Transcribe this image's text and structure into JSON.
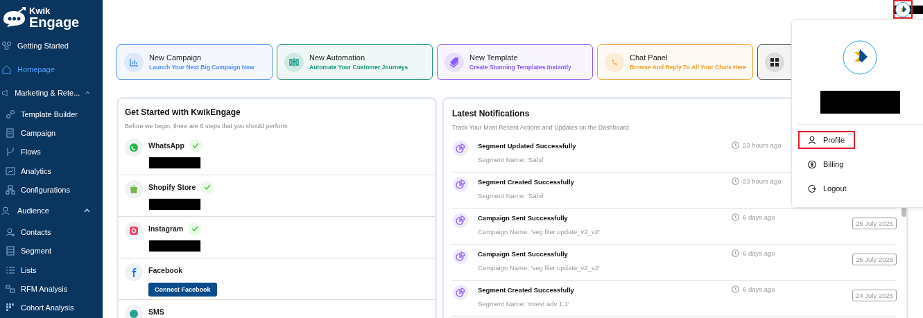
{
  "logo": {
    "line1": "Kwik",
    "line2": "Engage"
  },
  "sidebar": {
    "items": [
      {
        "label": "Getting Started",
        "selected": false
      },
      {
        "label": "Homepage",
        "selected": true
      },
      {
        "label": "Marketing & Rete...",
        "selected": false,
        "expanded": true,
        "children": [
          {
            "label": "Template Builder",
            "selected": false
          },
          {
            "label": "Campaign",
            "selected": false
          },
          {
            "label": "Flows",
            "selected": false
          },
          {
            "label": "Analytics",
            "selected": false
          },
          {
            "label": "Configurations",
            "selected": false
          }
        ]
      },
      {
        "label": "Audience",
        "selected": false,
        "expanded": true,
        "children": [
          {
            "label": "Contacts",
            "selected": false
          },
          {
            "label": "Segment",
            "selected": false
          },
          {
            "label": "Lists",
            "selected": false
          },
          {
            "label": "RFM Analysis",
            "selected": false
          },
          {
            "label": "Cohort Analysis",
            "selected": false
          }
        ]
      }
    ]
  },
  "quick_actions": [
    {
      "title": "New Campaign",
      "subtitle": "Launch Your Next Big Campaign Now",
      "color": "#4f8ef7"
    },
    {
      "title": "New Automation",
      "subtitle": "Automate Your Customer Journeys",
      "color": "#16957c"
    },
    {
      "title": "New Template",
      "subtitle": "Create Stunning Templates Instantly",
      "color": "#8b5cf6"
    },
    {
      "title": "Chat Panel",
      "subtitle": "Browse And Reply To All Your Chats Here",
      "color": "#f0a030"
    },
    {
      "color": "#555555"
    }
  ],
  "get_started": {
    "title": "Get Started with KwikEngage",
    "subtitle": "Before we begin, there are 6 steps that you should perform",
    "steps": [
      {
        "name": "WhatsApp",
        "connected": true
      },
      {
        "name": "Shopify Store",
        "connected": true
      },
      {
        "name": "Instagram",
        "connected": true
      },
      {
        "name": "Facebook",
        "connected": false,
        "button": "Connect Facebook"
      },
      {
        "name": "SMS",
        "connected": false
      }
    ]
  },
  "notifications": {
    "title": "Latest Notifications",
    "subtitle": "Track Your Most Recent Actions and Updates on the Dashboard",
    "items": [
      {
        "title": "Segment Updated Successfully",
        "detail": "Segment Name: 'Sahil'",
        "time": "23 hours ago"
      },
      {
        "title": "Segment Created Successfully",
        "detail": "Segment Name: 'Sahil'",
        "time": "23 hours ago"
      },
      {
        "title": "Campaign Sent Successfully",
        "detail": "Campaign Name: 'seg filer update_v2_v2'",
        "time": "6 days ago",
        "date": "25 July 2025"
      },
      {
        "title": "Campaign Sent Successfully",
        "detail": "Campaign Name: 'seg filer update_v2_v2'",
        "time": "6 days ago",
        "date": "25 July 2025"
      },
      {
        "title": "Segment Created Successfully",
        "detail": "Segment Name: 'mtest adv 1.1'",
        "time": "6 days ago",
        "date": "24 July 2025"
      }
    ]
  },
  "profile_menu": {
    "avatar_annotated": true,
    "items": [
      {
        "label": "Profile",
        "annotated": true
      },
      {
        "label": "Billing",
        "annotated": false
      },
      {
        "label": "Logout",
        "annotated": false
      }
    ]
  }
}
